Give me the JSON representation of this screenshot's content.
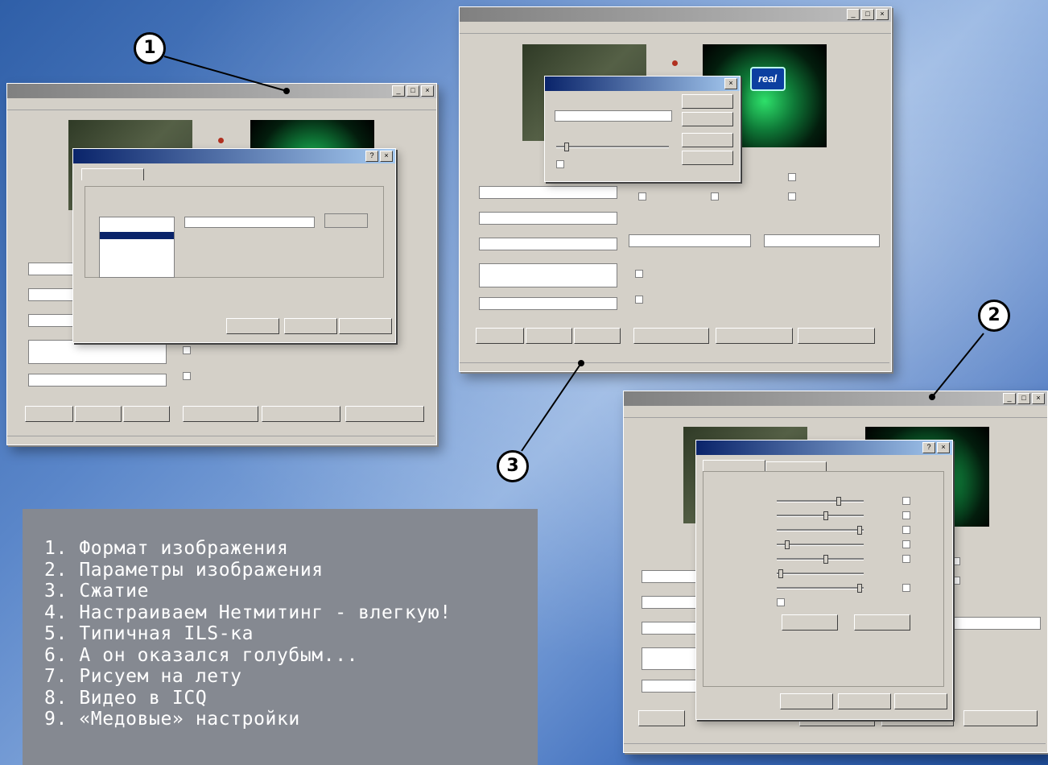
{
  "callouts": {
    "c1": "1",
    "c2": "2",
    "c3": "3"
  },
  "logo_text": "real",
  "legend": {
    "items": [
      {
        "num": "1.",
        "text": "Формат изображения"
      },
      {
        "num": "2.",
        "text": "Параметры изображения"
      },
      {
        "num": "3.",
        "text": "Сжатие"
      },
      {
        "num": "4.",
        "text": "Настраиваем Нетмитинг - влегкую!"
      },
      {
        "num": "5.",
        "text": "Типичная ILS-ка"
      },
      {
        "num": "6.",
        "text": "А он оказался голубым..."
      },
      {
        "num": "7.",
        "text": "Рисуем на лету"
      },
      {
        "num": "8.",
        "text": "Видео в ICQ"
      },
      {
        "num": "9.",
        "text": "«Медовые» настройки"
      }
    ]
  },
  "colors": {
    "panel": "#858991",
    "win_face": "#d4d0c8",
    "title_active": "#0a246a"
  }
}
